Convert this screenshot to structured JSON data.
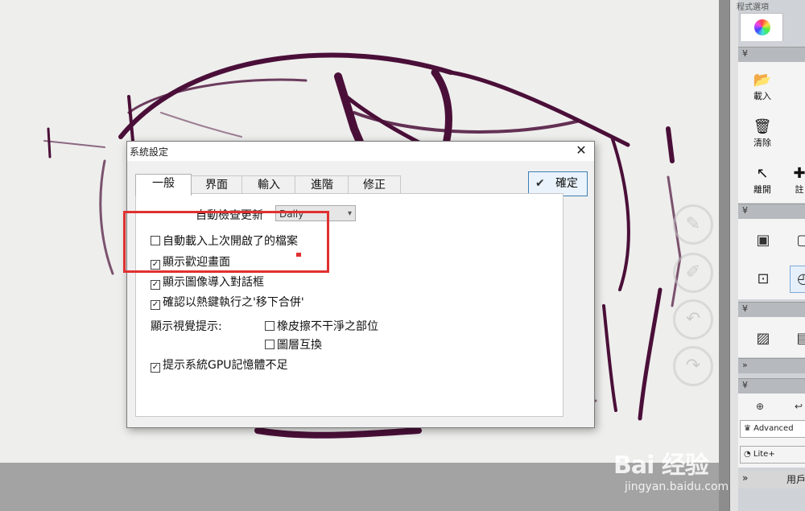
{
  "panel": {
    "title": "程式選項",
    "tools": [
      "載入",
      "清除",
      "離開",
      "註"
    ],
    "user_bar_label": "用戶",
    "items": [
      "Advanced",
      "Lite+"
    ],
    "collapse_glyph": "»"
  },
  "dialog": {
    "title": "系統設定",
    "close_glyph": "✕",
    "ok_label": "確定",
    "tabs": [
      "一般",
      "界面",
      "輸入",
      "進階",
      "修正"
    ],
    "update_label": "自動檢查更新",
    "update_value": "Daily",
    "options": {
      "auto_load_last": "自動載入上次開啟了的檔案",
      "show_welcome": "顯示歡迎畫面",
      "show_image_import": "顯示圖像導入對話框",
      "confirm_hotkey_merge": "確認以熱鍵執行之'移下合併'",
      "visual_hints_label": "顯示視覺提示:",
      "eraser_dirty": "橡皮擦不干淨之部位",
      "layer_swap": "圖層互換",
      "gpu_memory_warning": "提示系統GPU記憶體不足"
    },
    "checked": {
      "auto_load_last": false,
      "show_welcome": true,
      "show_image_import": true,
      "confirm_hotkey_merge": true,
      "eraser_dirty": false,
      "layer_swap": false,
      "gpu_memory_warning": true
    }
  },
  "watermark": {
    "logo": "Bai 经验",
    "url": "jingyan.baidu.com"
  },
  "colors": {
    "accent": "#3c7fb1",
    "highlight": "#e03030",
    "ink": "#4a0f38"
  }
}
